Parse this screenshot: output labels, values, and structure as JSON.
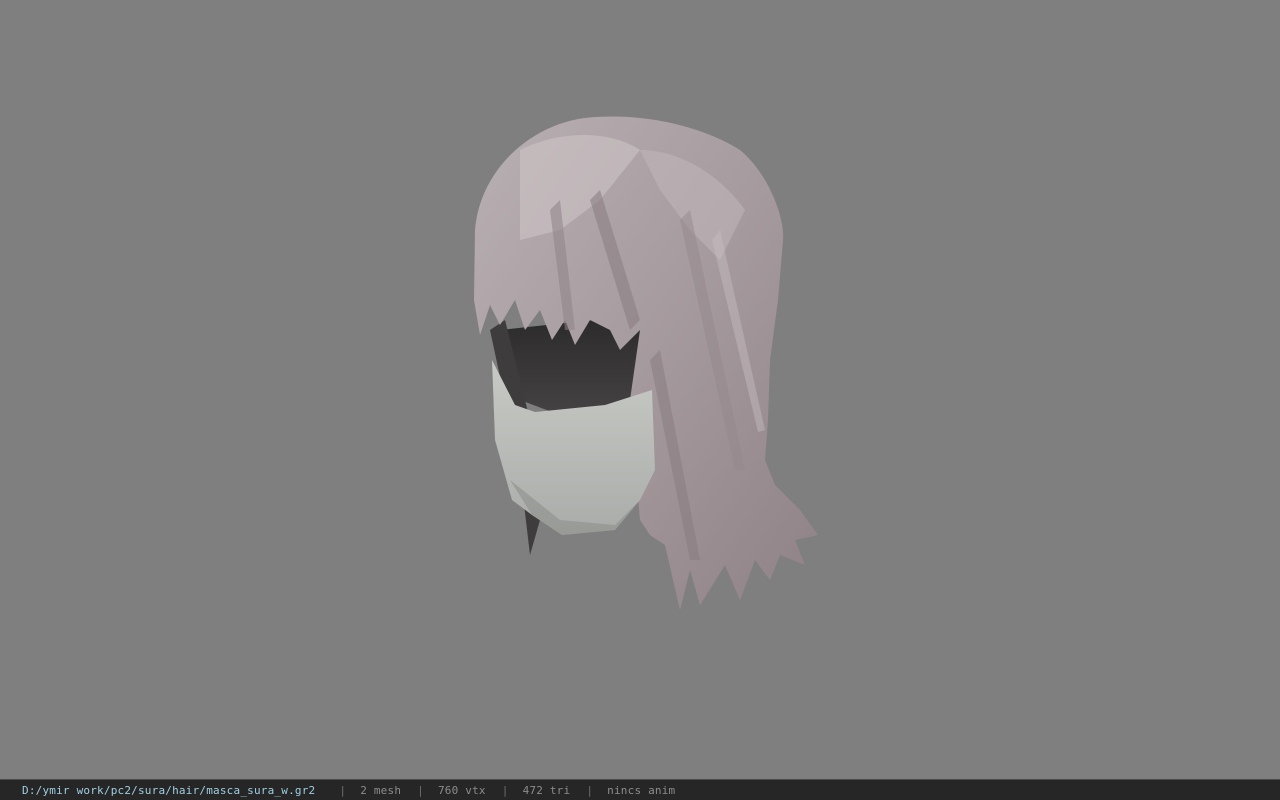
{
  "viewport": {
    "background": "#7f7f7f",
    "model": "hair-mesh"
  },
  "statusbar": {
    "path": "D:/ymir work/pc2/sura/hair/masca_sura_w.gr2",
    "separator": "|",
    "mesh": "2 mesh",
    "vtx": "760 vtx",
    "tri": "472 tri",
    "anim": "nincs anim"
  }
}
